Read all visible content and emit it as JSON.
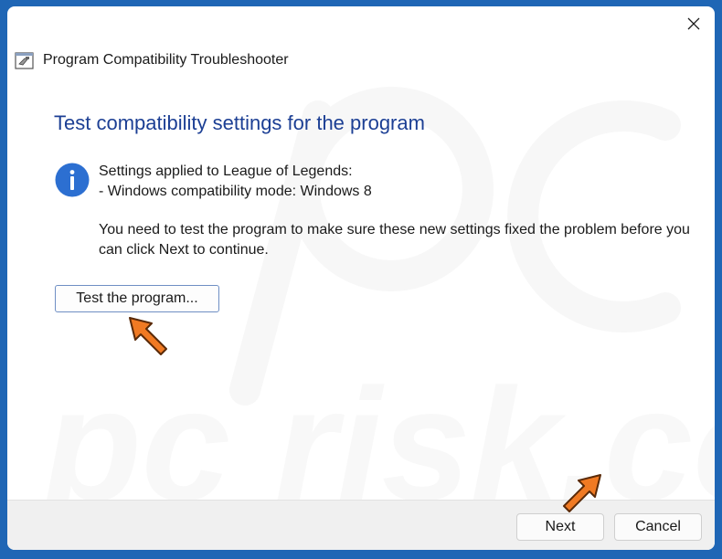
{
  "window": {
    "title": "Program Compatibility Troubleshooter",
    "close_icon": "close-icon"
  },
  "main": {
    "heading": "Test compatibility settings for the program",
    "info_icon": "info-icon",
    "settings_line": "Settings applied to League of Legends:",
    "mode_line": "- Windows compatibility mode: Windows 8",
    "instruction": "You need to test the program to make sure these new settings fixed the problem before you can click Next to continue.",
    "test_button": "Test the program..."
  },
  "footer": {
    "next_button": "Next",
    "cancel_button": "Cancel"
  },
  "watermark_text": "pc risk.com",
  "colors": {
    "heading": "#1c3f94",
    "info_icon": "#2c6fd1",
    "arrow": "#f07a23",
    "backdrop": "#1f66b5"
  }
}
